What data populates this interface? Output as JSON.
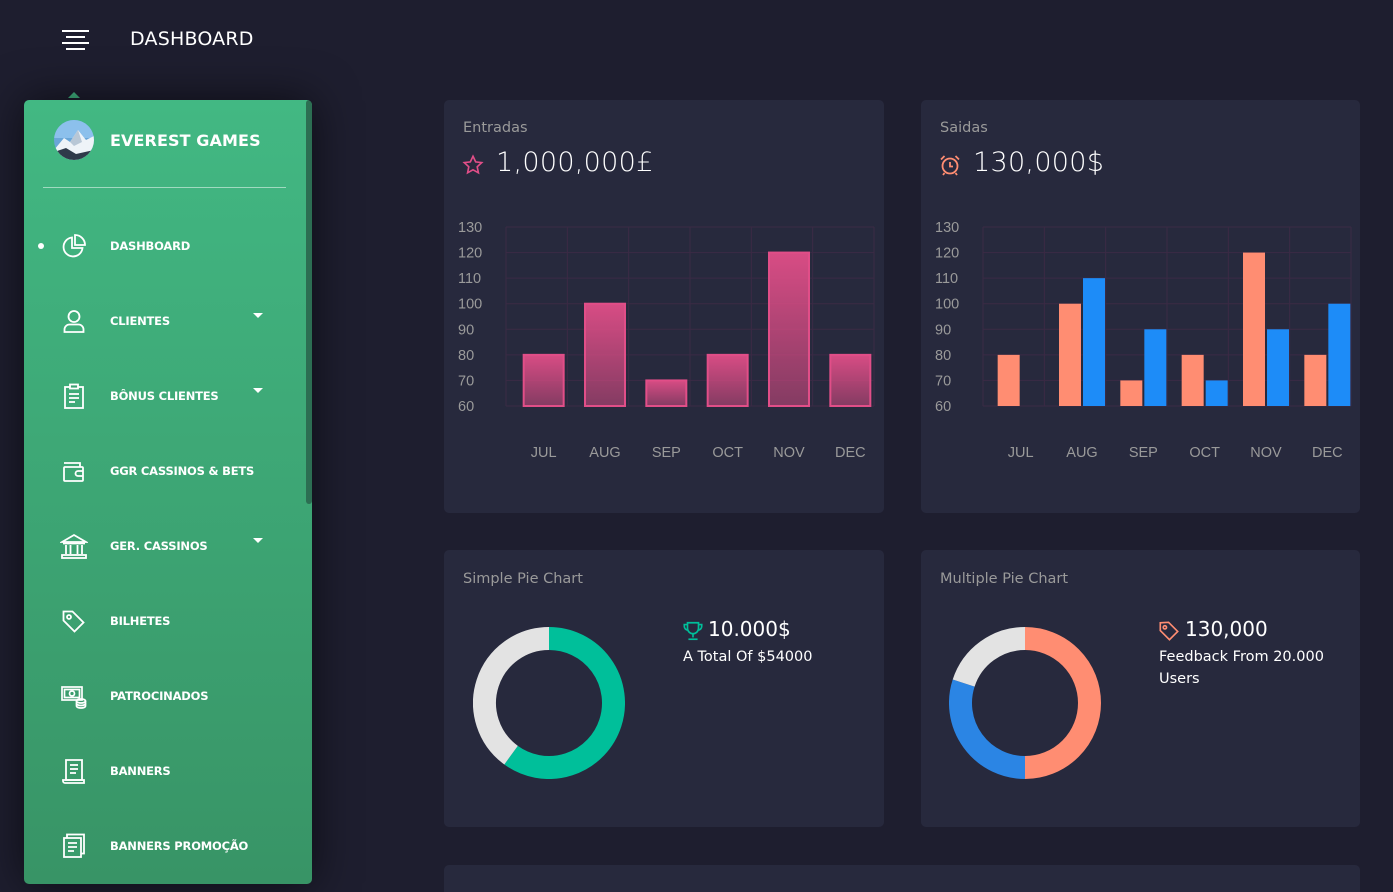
{
  "header": {
    "title": "DASHBOARD"
  },
  "sidebar": {
    "brand": "EVEREST GAMES",
    "items": [
      {
        "label": "DASHBOARD",
        "active": true,
        "has_caret": false,
        "icon": "chart-pie-icon"
      },
      {
        "label": "CLIENTES",
        "active": false,
        "has_caret": true,
        "icon": "user-icon"
      },
      {
        "label": "BÔNUS CLIENTES",
        "active": false,
        "has_caret": true,
        "icon": "clipboard-icon"
      },
      {
        "label": "GGR CASSINOS & BETS",
        "active": false,
        "has_caret": false,
        "icon": "wallet-icon"
      },
      {
        "label": "GER. CASSINOS",
        "active": false,
        "has_caret": true,
        "icon": "bank-icon"
      },
      {
        "label": "BILHETES",
        "active": false,
        "has_caret": false,
        "icon": "tag-icon"
      },
      {
        "label": "PATROCINADOS",
        "active": false,
        "has_caret": false,
        "icon": "money-coins-icon"
      },
      {
        "label": "BANNERS",
        "active": false,
        "has_caret": false,
        "icon": "paper-icon"
      },
      {
        "label": "BANNERS PROMOÇÃO",
        "active": false,
        "has_caret": false,
        "icon": "single-copy-icon"
      }
    ]
  },
  "cards": {
    "entradas": {
      "label": "Entradas",
      "value": "1,000,000£",
      "icon": "star-icon"
    },
    "saidas": {
      "label": "Saidas",
      "value": "130,000$",
      "icon": "alarm-clock-icon"
    },
    "simple_pie": {
      "label": "Simple Pie Chart",
      "heading": "10.000$",
      "subtext": "A Total Of $54000",
      "icon": "trophy-icon"
    },
    "multiple_pie": {
      "label": "Multiple Pie Chart",
      "heading": "130,000",
      "subtext": "Feedback From 20.000 Users",
      "icon": "tag-icon"
    }
  },
  "colors": {
    "accent_green": "#42b883",
    "bar_pink": "#e14eca",
    "bar_salmon": "#ff8d72",
    "bar_blue": "#1d8cf8",
    "teal": "#00bf9a",
    "light_grey": "#e3e3e3",
    "blue": "#2b85e4"
  },
  "chart_data": [
    {
      "type": "bar",
      "categories": [
        "JUL",
        "AUG",
        "SEP",
        "OCT",
        "NOV",
        "DEC"
      ],
      "series": [
        {
          "values": [
            80,
            100,
            70,
            80,
            120,
            80
          ],
          "color": "#e14e88"
        }
      ],
      "yticks": [
        130,
        120,
        110,
        100,
        90,
        80,
        70,
        60
      ],
      "ylim": [
        60,
        130
      ],
      "grid": true
    },
    {
      "type": "bar",
      "categories": [
        "JUL",
        "AUG",
        "SEP",
        "OCT",
        "NOV",
        "DEC"
      ],
      "series": [
        {
          "values": [
            80,
            100,
            70,
            80,
            120,
            80
          ],
          "color": "#ff8d72"
        },
        {
          "values": [
            null,
            110,
            90,
            70,
            90,
            100
          ],
          "color": "#1d8cf8"
        }
      ],
      "yticks": [
        130,
        120,
        110,
        100,
        90,
        80,
        70,
        60
      ],
      "ylim": [
        60,
        130
      ],
      "grid": true
    },
    {
      "type": "pie",
      "slices": [
        {
          "value": 60,
          "color": "#00bf9a"
        },
        {
          "value": 40,
          "color": "#e3e3e3"
        }
      ]
    },
    {
      "type": "pie",
      "slices": [
        {
          "value": 50,
          "color": "#ff8d72"
        },
        {
          "value": 30,
          "color": "#2b85e4"
        },
        {
          "value": 20,
          "color": "#e3e3e3"
        }
      ]
    }
  ]
}
